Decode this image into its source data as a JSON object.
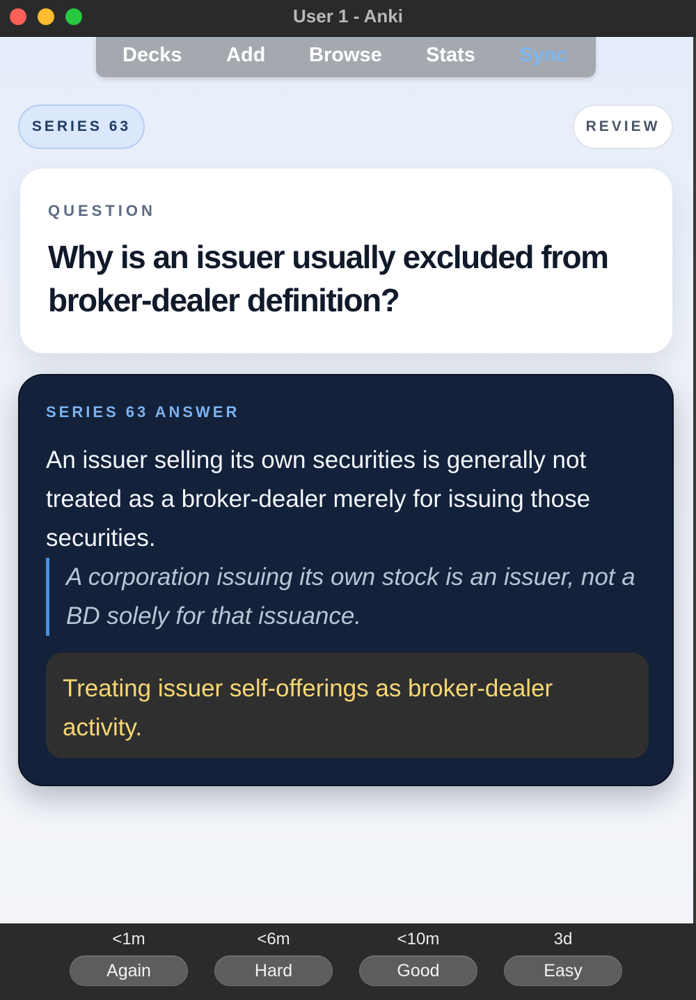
{
  "window": {
    "title": "User 1 - Anki"
  },
  "topnav": {
    "decks": "Decks",
    "add": "Add",
    "browse": "Browse",
    "stats": "Stats",
    "sync": "Sync"
  },
  "pills": {
    "series": "SERIES 63",
    "review": "REVIEW"
  },
  "question": {
    "label": "QUESTION",
    "text": "Why is an issuer usually excluded from broker-dealer definition?"
  },
  "answer": {
    "label": "SERIES 63 ANSWER",
    "text": "An issuer selling its own securities is generally not treated as a broker-dealer merely for issuing those securities.",
    "example": "A corporation issuing its own stock is an issuer, not a BD solely for that issuance.",
    "pitfall": "Treating issuer self-offerings as broker-dealer activity."
  },
  "ease_buttons": [
    {
      "time": "<1m",
      "label": "Again"
    },
    {
      "time": "<6m",
      "label": "Hard"
    },
    {
      "time": "<10m",
      "label": "Good"
    },
    {
      "time": "3d",
      "label": "Easy"
    }
  ],
  "colors": {
    "accent_blue": "#7cb2f0",
    "answer_bg": "#13213a",
    "pitfall_text": "#f7d774"
  }
}
